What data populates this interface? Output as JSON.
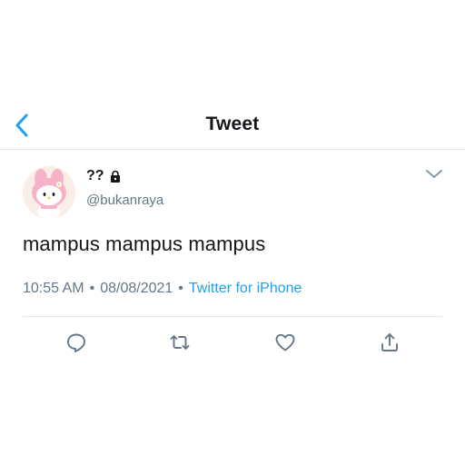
{
  "header": {
    "title": "Tweet",
    "back_icon": "chevron-left-icon",
    "accent_color": "#1da1f2"
  },
  "tweet": {
    "user_name": "??",
    "protected_icon": "lock-icon",
    "handle": "@bukanraya",
    "text": "mampus mampus mampus",
    "time": "10:55 AM",
    "separator": "•",
    "date": "08/08/2021",
    "source": "Twitter for iPhone",
    "more_icon": "chevron-down-icon"
  },
  "actions": [
    {
      "name": "reply",
      "icon": "reply-icon"
    },
    {
      "name": "retweet",
      "icon": "retweet-icon"
    },
    {
      "name": "like",
      "icon": "heart-icon"
    },
    {
      "name": "share",
      "icon": "share-icon"
    }
  ],
  "colors": {
    "text": "#14171a",
    "secondary": "#657786",
    "link": "#1da1f2",
    "border": "#e1e8ed"
  }
}
